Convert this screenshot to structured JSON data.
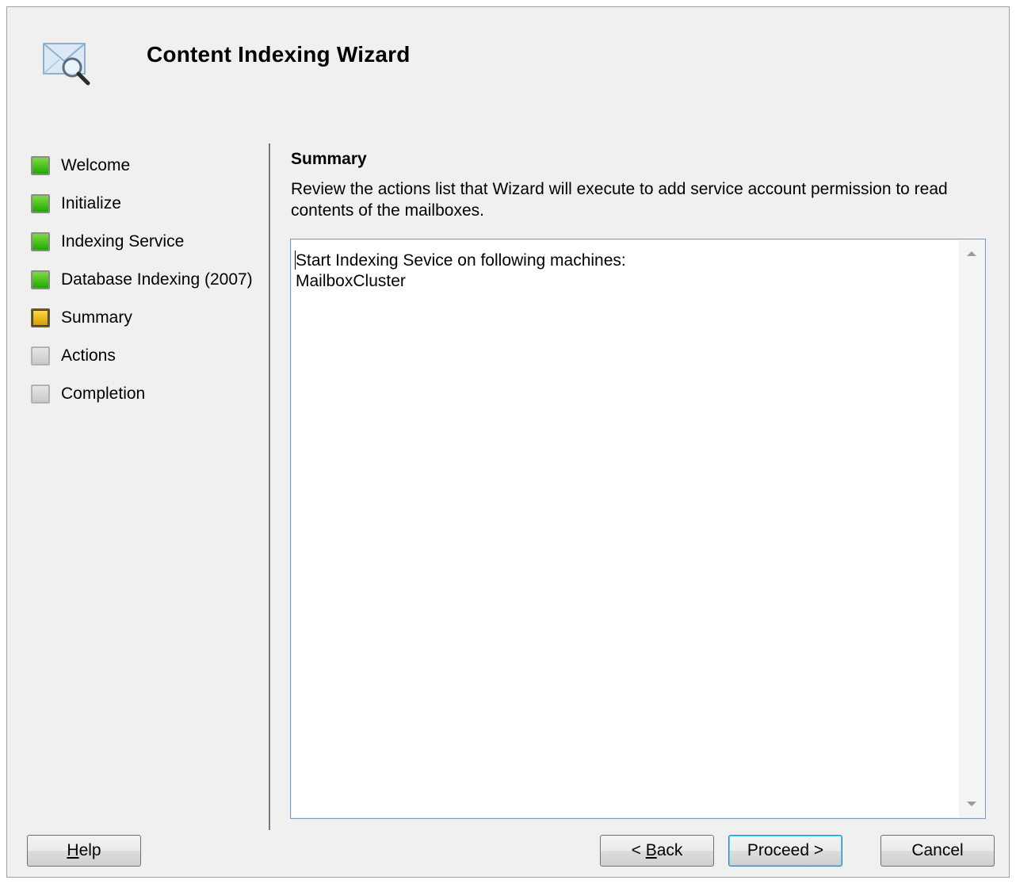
{
  "header": {
    "title": "Content Indexing Wizard",
    "icon": "envelope-search-icon"
  },
  "steps": [
    {
      "label": "Welcome",
      "status": "complete",
      "color": "#25a70a"
    },
    {
      "label": "Initialize",
      "status": "complete",
      "color": "#25a70a"
    },
    {
      "label": "Indexing Service",
      "status": "complete",
      "color": "#25a70a"
    },
    {
      "label": "Database Indexing (2007)",
      "status": "complete",
      "color": "#25a70a"
    },
    {
      "label": "Summary",
      "status": "current",
      "color": "#d49c00"
    },
    {
      "label": "Actions",
      "status": "pending",
      "color": "#c8c8c8"
    },
    {
      "label": "Completion",
      "status": "pending",
      "color": "#c8c8c8"
    }
  ],
  "summary": {
    "title": "Summary",
    "description": "Review the actions list that Wizard will execute to add service account permission to read contents of the mailboxes.",
    "actions_text": "Start Indexing Sevice on following machines:\nMailboxCluster"
  },
  "buttons": {
    "help": {
      "mnemonic": "H",
      "rest": "elp"
    },
    "back": {
      "prefix": "< ",
      "mnemonic": "B",
      "rest": "ack"
    },
    "proceed": "Proceed >",
    "cancel": "Cancel"
  }
}
